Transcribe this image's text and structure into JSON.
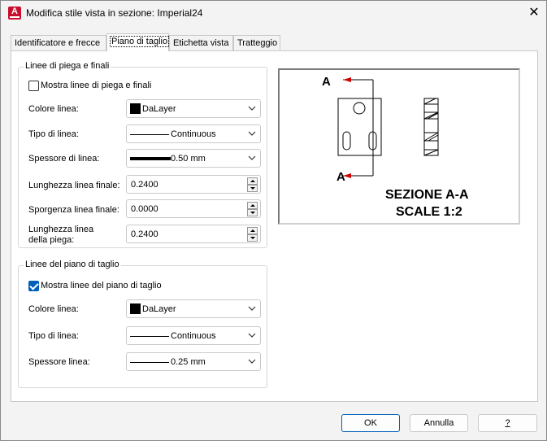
{
  "window": {
    "title": "Modifica stile vista in sezione: Imperial24",
    "close_glyph": "✕",
    "app_icon_letter": "A"
  },
  "tabs": [
    {
      "label": "Identificatore e frecce",
      "active": false
    },
    {
      "label": "Piano di taglio",
      "active": true
    },
    {
      "label": "Etichetta vista",
      "active": false
    },
    {
      "label": "Tratteggio",
      "active": false
    }
  ],
  "bend": {
    "group_title": "Linee di piega e finali",
    "show_checkbox": {
      "label": "Mostra linee di piega e finali",
      "checked": false
    },
    "line_color": {
      "label": "Colore linea:",
      "value": "DaLayer",
      "swatch": "#000000"
    },
    "line_type": {
      "label": "Tipo di linea:",
      "value": "Continuous"
    },
    "line_weight": {
      "label": "Spessore di linea:",
      "value": "0.50 mm"
    },
    "end_length": {
      "label": "Lunghezza linea finale:",
      "value": "0.2400"
    },
    "end_overshoot": {
      "label": "Sporgenza linea finale:",
      "value": "0.0000"
    },
    "bend_length": {
      "label_line1": "Lunghezza linea",
      "label_line2": "della piega:",
      "value": "0.2400"
    }
  },
  "cutting": {
    "group_title": "Linee del piano di taglio",
    "show_checkbox": {
      "label": "Mostra linee del piano di taglio",
      "checked": true
    },
    "line_color": {
      "label": "Colore linea:",
      "value": "DaLayer",
      "swatch": "#000000"
    },
    "line_type": {
      "label": "Tipo di linea:",
      "value": "Continuous"
    },
    "line_weight": {
      "label": "Spessore linea:",
      "value": "0.25 mm"
    }
  },
  "preview": {
    "marker_top": "A",
    "marker_bottom": "A",
    "caption_line1": "SEZIONE A-A",
    "caption_line2": "SCALE 1:2"
  },
  "buttons": {
    "ok": "OK",
    "cancel": "Annulla",
    "help": "?"
  },
  "colors": {
    "accent": "#005fb8",
    "arrow_red": "#d00000"
  }
}
